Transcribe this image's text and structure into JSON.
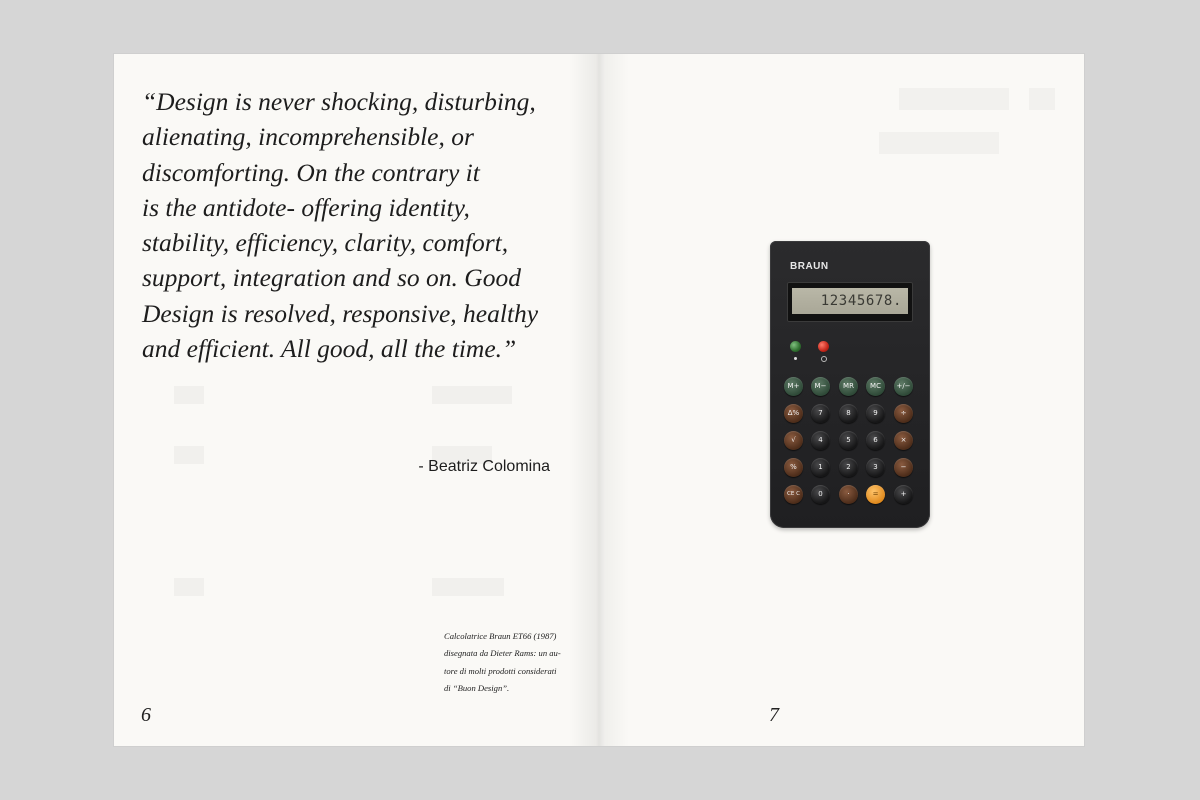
{
  "left_page": {
    "quote_lines": [
      "“Design is never shocking, disturbing,",
      "alienating, incomprehensible, or",
      "discomforting. On the contrary it",
      "is the antidote- offering identity,",
      "stability, efficiency, clarity, comfort,",
      "support, integration and so on. Good",
      "Design is resolved, responsive, healthy",
      "and efficient. All good, all the time.”"
    ],
    "author": "- Beatriz Colomina",
    "caption_lines": [
      "Calcolatrice Braun ET66 (1987)",
      "disegnata da Dieter Rams: un au-",
      "tore di molti prodotti considerati",
      "di “Buon Design”."
    ],
    "page_number": "6"
  },
  "right_page": {
    "page_number": "7",
    "calculator": {
      "brand": "BRAUN",
      "display": "12345678.",
      "keys": [
        [
          "M+",
          "M−",
          "MR",
          "MC",
          "+/−"
        ],
        [
          "Δ%",
          "7",
          "8",
          "9",
          "÷"
        ],
        [
          "√",
          "4",
          "5",
          "6",
          "×"
        ],
        [
          "%",
          "1",
          "2",
          "3",
          "−"
        ],
        [
          "CE C",
          "0",
          "·",
          "=",
          "+"
        ]
      ]
    }
  },
  "colors": {
    "background": "#d6d6d6",
    "paper": "#faf9f6",
    "text": "#1d1d1d",
    "calculator_body": "#262628",
    "key_green": "#3b5a45",
    "key_brown": "#6a3f27",
    "key_black": "#1b1b1c",
    "key_yellow": "#f0a033",
    "led_green": "#3f8f3f",
    "led_red": "#d2281c"
  }
}
